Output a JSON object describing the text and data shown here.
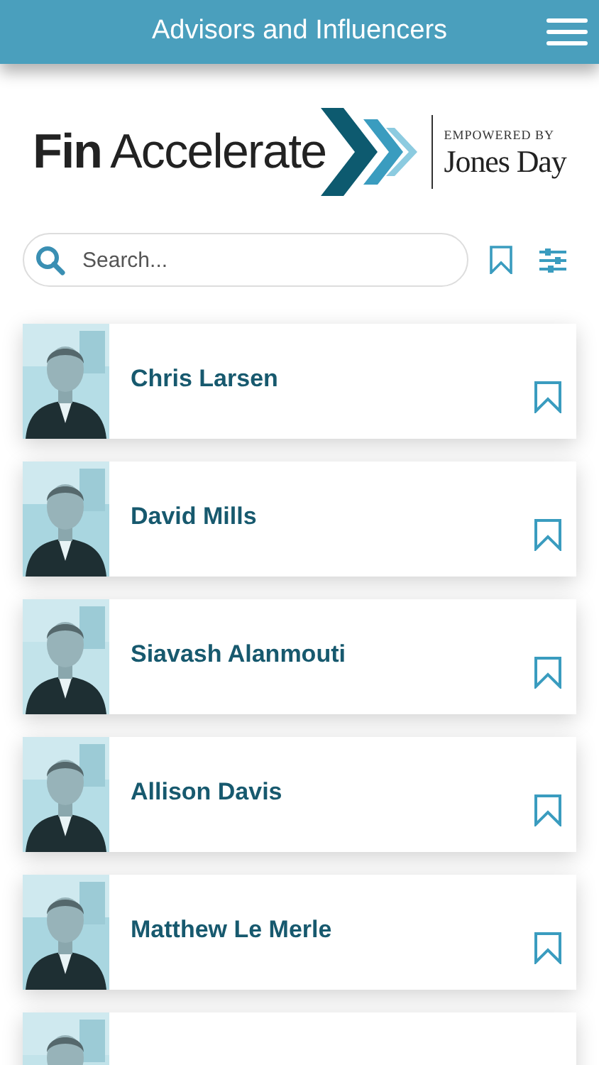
{
  "header": {
    "title": "Advisors and Influencers"
  },
  "logo": {
    "brand_bold": "Fin",
    "brand_light": "Accelerate",
    "tagline": "EMPOWERED BY",
    "partner": "Jones Day"
  },
  "search": {
    "placeholder": "Search..."
  },
  "people": [
    {
      "name": "Chris Larsen",
      "bookmarked": false,
      "photo": {
        "kind": "picture"
      }
    },
    {
      "name": "David Mills",
      "bookmarked": false,
      "photo": {
        "kind": "picture"
      }
    },
    {
      "name": "Siavash Alanmouti",
      "bookmarked": false,
      "photo": {
        "kind": "picture"
      }
    },
    {
      "name": "Allison Davis",
      "bookmarked": false,
      "photo": {
        "kind": "picture"
      }
    },
    {
      "name": "Matthew Le Merle",
      "bookmarked": false,
      "photo": {
        "kind": "picture"
      }
    },
    {
      "photo": {
        "kind": "picture"
      }
    }
  ]
}
